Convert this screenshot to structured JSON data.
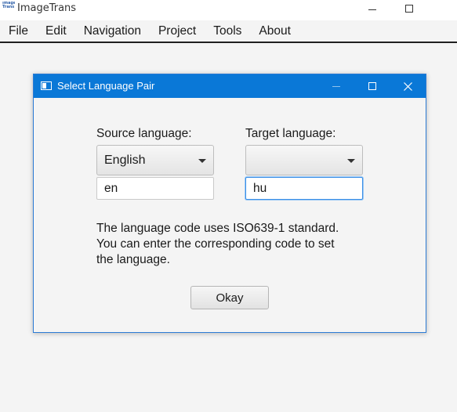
{
  "app": {
    "title": "ImageTrans",
    "logo_lines": [
      "Image",
      "Trans"
    ]
  },
  "menu": {
    "items": [
      {
        "label": "File"
      },
      {
        "label": "Edit"
      },
      {
        "label": "Navigation"
      },
      {
        "label": "Project"
      },
      {
        "label": "Tools"
      },
      {
        "label": "About"
      }
    ]
  },
  "dialog": {
    "title": "Select Language Pair",
    "source": {
      "label": "Source language:",
      "selected": "English",
      "code": "en"
    },
    "target": {
      "label": "Target language:",
      "selected": "",
      "code": "hu"
    },
    "help_lines": [
      "The language code uses ISO639-1 standard.",
      "You can enter the corresponding code to set",
      "the language."
    ],
    "okay_label": "Okay"
  },
  "colors": {
    "accent": "#0a78d7",
    "focus_border": "#3a8ee6",
    "background": "#f4f4f4"
  },
  "icons": {
    "dialog": "window-icon",
    "dropdown": "chevron-down-icon",
    "close": "close-icon"
  }
}
